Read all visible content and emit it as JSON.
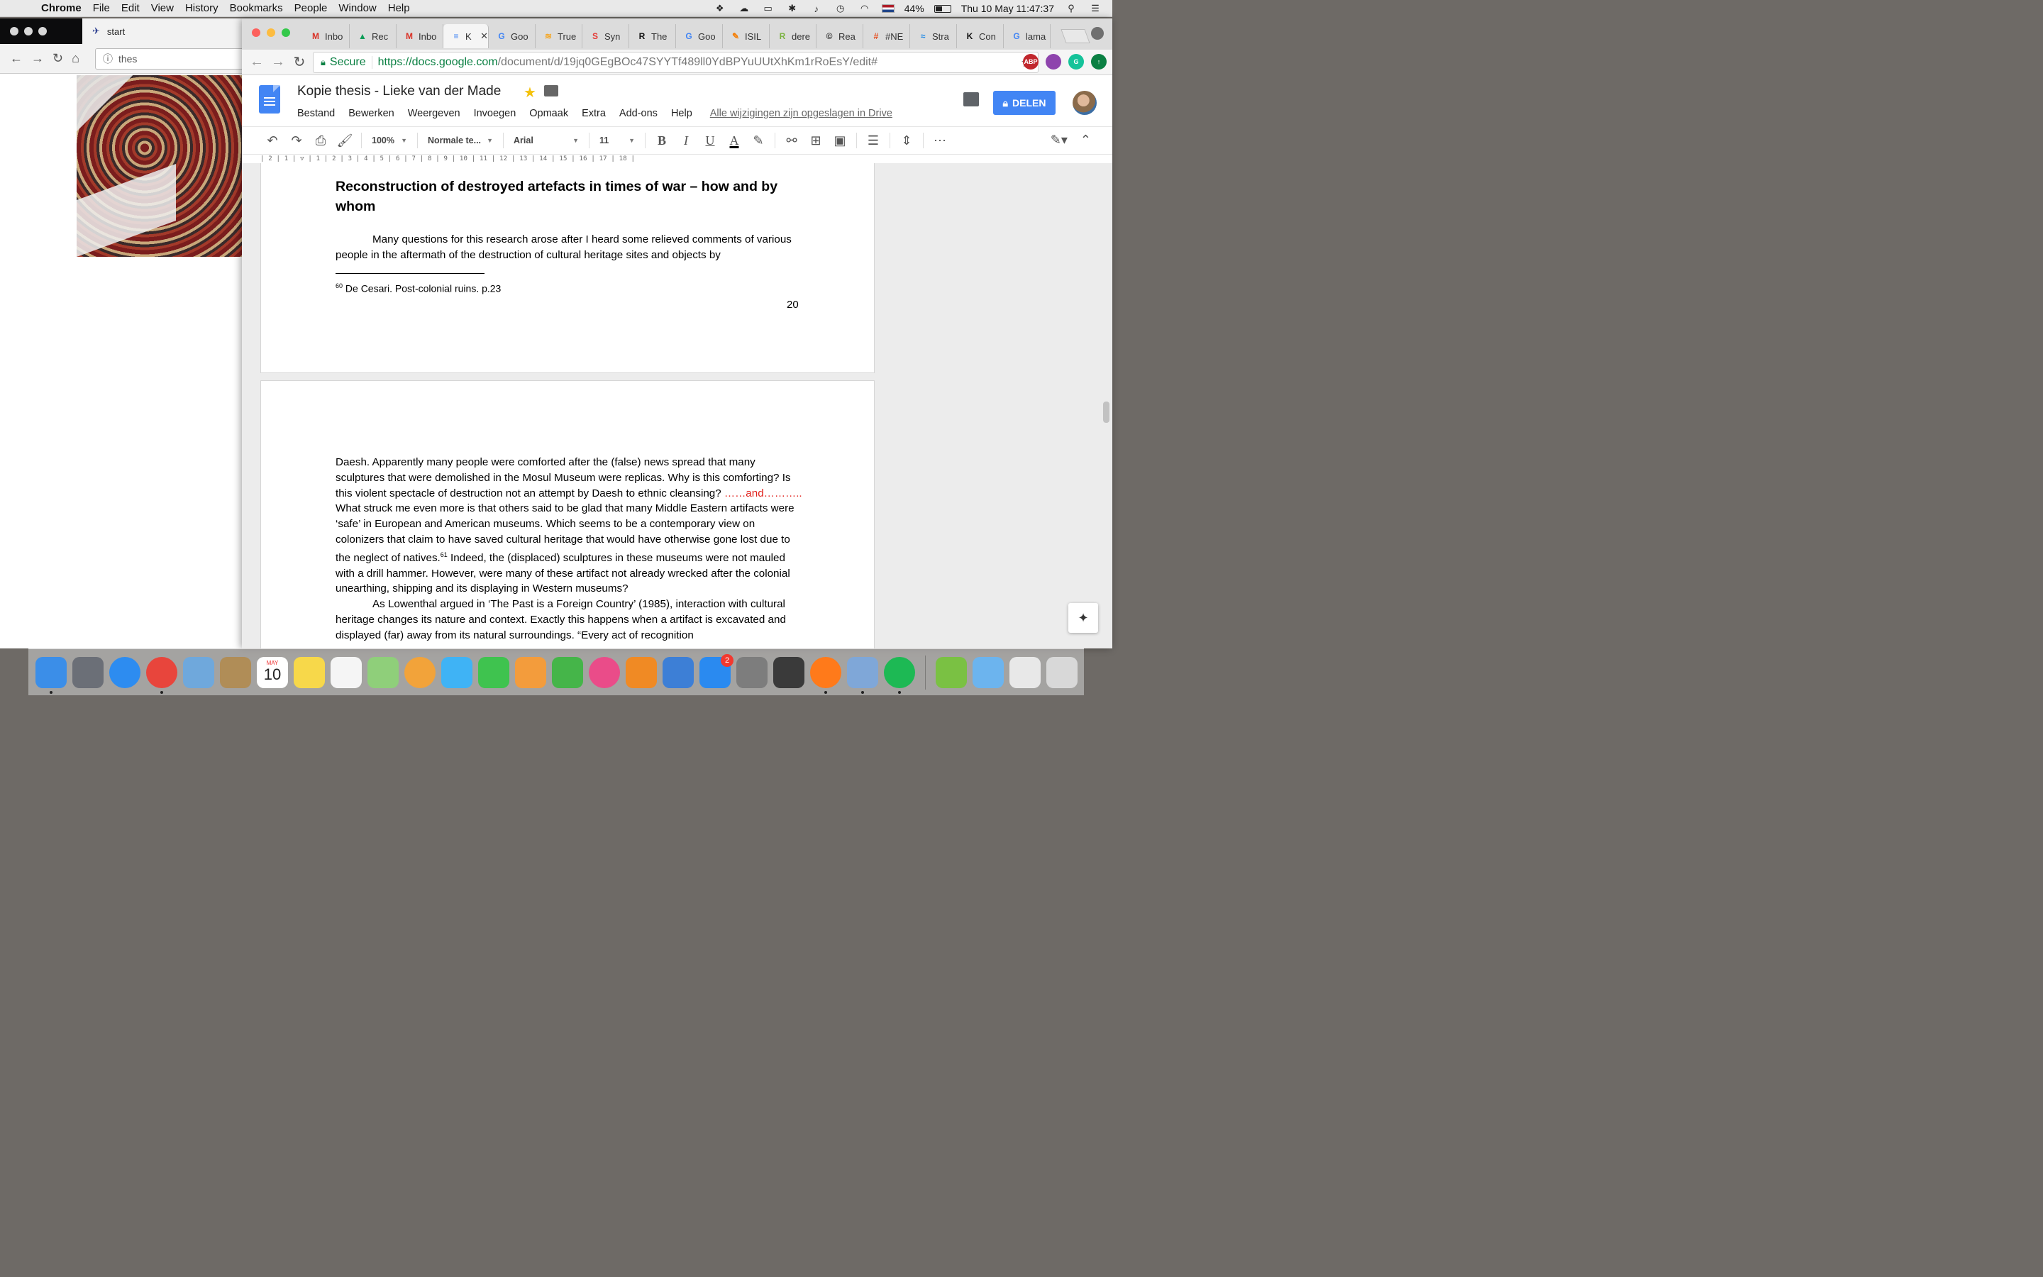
{
  "menubar": {
    "app": "Chrome",
    "items": [
      "File",
      "Edit",
      "View",
      "History",
      "Bookmarks",
      "People",
      "Window",
      "Help"
    ],
    "battery": "44%",
    "clock": "Thu 10 May  11:47:37"
  },
  "bg_window": {
    "tab_title": "start",
    "url_partial": "thes"
  },
  "chrome": {
    "tabs": [
      {
        "label": "Inbo",
        "icon": "gmail-icon",
        "color": "#d93025",
        "glyph": "M"
      },
      {
        "label": "Rec",
        "icon": "drive-icon",
        "color": "#0f9d58",
        "glyph": "▲"
      },
      {
        "label": "Inbo",
        "icon": "gmail-icon",
        "color": "#d93025",
        "glyph": "M"
      },
      {
        "label": "K",
        "icon": "docs-icon",
        "color": "#4285f4",
        "glyph": "≡",
        "active": true
      },
      {
        "label": "Goo",
        "icon": "google-translate-icon",
        "color": "#4285f4",
        "glyph": "G"
      },
      {
        "label": "True",
        "icon": "rss-icon",
        "color": "#f5a623",
        "glyph": "≋"
      },
      {
        "label": "Syn",
        "icon": "synonym-icon",
        "color": "#e53935",
        "glyph": "S"
      },
      {
        "label": "The",
        "icon": "r-icon",
        "color": "#111111",
        "glyph": "R"
      },
      {
        "label": "Goo",
        "icon": "google-translate-icon",
        "color": "#4285f4",
        "glyph": "G"
      },
      {
        "label": "ISIL",
        "icon": "pen-icon",
        "color": "#f57c00",
        "glyph": "✎"
      },
      {
        "label": "dere",
        "icon": "r-green-icon",
        "color": "#7cb342",
        "glyph": "R"
      },
      {
        "label": "Rea",
        "icon": "cc-icon",
        "color": "#222222",
        "glyph": "©"
      },
      {
        "label": "#NE",
        "icon": "hash-icon",
        "color": "#e64a19",
        "glyph": "#"
      },
      {
        "label": "Stra",
        "icon": "strava-icon",
        "color": "#1e88e5",
        "glyph": "≈"
      },
      {
        "label": "Con",
        "icon": "k-icon",
        "color": "#111111",
        "glyph": "K"
      },
      {
        "label": "lama",
        "icon": "google-icon",
        "color": "#4285f4",
        "glyph": "G"
      }
    ],
    "url": {
      "secure_label": "Secure",
      "host": "https://docs.google.com",
      "path": "/document/d/19jq0GEgBOc47SYYTf489ll0YdBPYuUUtXhKm1rRoEsY/edit#"
    },
    "extensions": [
      {
        "name": "adblock-icon",
        "text": "ABP",
        "color": "#c1272d"
      },
      {
        "name": "extension-icon",
        "text": "",
        "color": "#8e44ad"
      },
      {
        "name": "grammarly-icon",
        "text": "G",
        "color": "#15c39a"
      },
      {
        "name": "update-icon",
        "text": "↑",
        "color": "#0b8043"
      }
    ]
  },
  "docs": {
    "title": "Kopie thesis - Lieke van der Made",
    "menu": [
      "Bestand",
      "Bewerken",
      "Weergeven",
      "Invoegen",
      "Opmaak",
      "Extra",
      "Add-ons",
      "Help"
    ],
    "saved_status": "Alle wijzigingen zijn opgeslagen in Drive",
    "share_label": "DELEN",
    "toolbar": {
      "zoom": "100%",
      "style": "Normale te...",
      "font": "Arial",
      "size": "11"
    },
    "ruler": "| 2 | 1 |  ▽ | 1 | 2 | 3 | 4 | 5 | 6 | 7 | 8 | 9 | 10 | 11 | 12 | 13 | 14 | 15 | 16 | 17 | 18 |"
  },
  "document": {
    "heading": "Reconstruction of destroyed artefacts in times of war – how and by whom",
    "para1": "Many questions for this research arose after I heard some relieved comments of various people in the aftermath of the destruction of cultural heritage sites and objects by",
    "footnote_num": "60",
    "footnote": "De Cesari. Post-colonial ruins. p.23",
    "page_number": "20",
    "para2_a": "Daesh. Apparently many people were comforted after the (false) news spread that many sculptures that were demolished in the Mosul Museum were replicas. Why is this comforting? Is this violent spectacle of destruction not an attempt by Daesh to ethnic cleansing? ",
    "para2_red": "……and………..",
    "para3_a": "What struck me even more is that others said to be glad that many Middle Eastern artifacts were ‘safe’ in European and American museums. Which seems to be a contemporary view on colonizers that claim to have saved cultural heritage that would have otherwise gone lost due to the neglect of natives.",
    "para3_sup": "61",
    "para3_b": " Indeed, the (displaced) sculptures in these museums were not mauled with a drill hammer. However, were many of these artifact not already wrecked after the colonial unearthing, shipping and its displaying in Western museums?",
    "para4": "As Lowenthal argued in ‘The Past is a Foreign Country’ (1985), interaction with cultural heritage changes its nature and context. Exactly this happens when a artifact is excavated and displayed (far) away from its natural surroundings. “Every act of recognition"
  },
  "dock": {
    "calendar_month": "MAY",
    "calendar_day": "10",
    "appstore_badge": "2",
    "icons": [
      {
        "name": "finder-icon",
        "color": "#3b8ee8",
        "dot": true
      },
      {
        "name": "launchpad-icon",
        "color": "#6b6f77",
        "dot": false
      },
      {
        "name": "safari-icon",
        "color": "#2d8cf0",
        "dot": false
      },
      {
        "name": "chrome-icon",
        "color": "#e8453c",
        "dot": true
      },
      {
        "name": "mail-icon",
        "color": "#6fa8dc",
        "dot": false
      },
      {
        "name": "contacts-icon",
        "color": "#b08d57",
        "dot": false
      },
      {
        "name": "calendar-icon",
        "color": "#ffffff",
        "dot": false
      },
      {
        "name": "notes-icon",
        "color": "#f7d84a",
        "dot": false
      },
      {
        "name": "reminders-icon",
        "color": "#f5f5f5",
        "dot": false
      },
      {
        "name": "maps-icon",
        "color": "#8fcf7a",
        "dot": false
      },
      {
        "name": "photos-icon",
        "color": "#f2a33a",
        "dot": false
      },
      {
        "name": "messages-icon",
        "color": "#3fb3f5",
        "dot": false
      },
      {
        "name": "facetime-icon",
        "color": "#3fc34f",
        "dot": false
      },
      {
        "name": "pages-icon",
        "color": "#f39c3c",
        "dot": false
      },
      {
        "name": "numbers-icon",
        "color": "#45b549",
        "dot": false
      },
      {
        "name": "itunes-icon",
        "color": "#ea4c89",
        "dot": false
      },
      {
        "name": "ibooks-icon",
        "color": "#f08a24",
        "dot": false
      },
      {
        "name": "keynote-icon",
        "color": "#3d7fd6",
        "dot": false
      },
      {
        "name": "appstore-icon",
        "color": "#2a8af0",
        "dot": false
      },
      {
        "name": "system-preferences-icon",
        "color": "#7d7d7d",
        "dot": false
      },
      {
        "name": "screenshot-icon",
        "color": "#3a3a3a",
        "dot": false
      },
      {
        "name": "firefox-icon",
        "color": "#ff7a1a",
        "dot": true
      },
      {
        "name": "preview-icon",
        "color": "#7fa7d8",
        "dot": true
      },
      {
        "name": "spotify-icon",
        "color": "#1db954",
        "dot": true
      },
      {
        "name": "drive-backup-icon",
        "color": "#7ac143",
        "dot": false
      },
      {
        "name": "downloads-folder-icon",
        "color": "#6cb4ee",
        "dot": false
      },
      {
        "name": "documents-stack-icon",
        "color": "#e8e8e8",
        "dot": false
      },
      {
        "name": "trash-icon",
        "color": "#d8d8d8",
        "dot": false
      }
    ]
  }
}
